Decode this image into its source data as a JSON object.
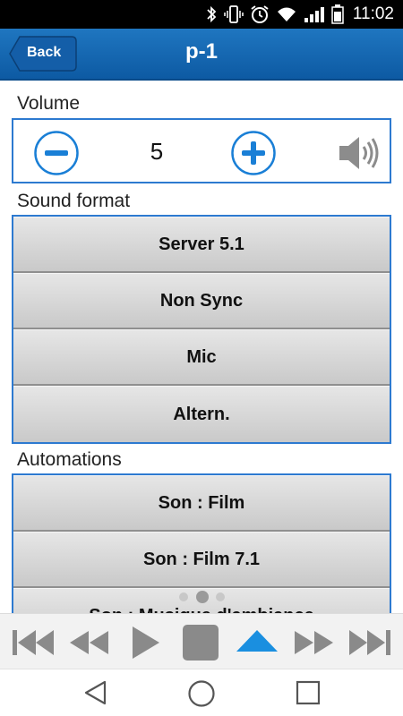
{
  "status_bar": {
    "time": "11:02",
    "icons": [
      "bluetooth-icon",
      "vibrate-icon",
      "alarm-icon",
      "wifi-icon",
      "signal-icon",
      "battery-icon"
    ]
  },
  "header": {
    "back_label": "Back",
    "title": "p-1"
  },
  "volume": {
    "label": "Volume",
    "value": "5",
    "accent": "#1a7fd6"
  },
  "sound_format": {
    "label": "Sound format",
    "buttons": [
      "Server 5.1",
      "Non Sync",
      "Mic",
      "Altern."
    ]
  },
  "automations": {
    "label": "Automations",
    "buttons": [
      "Son : Film",
      "Son : Film 7.1",
      "Son : Musique d'ambiance"
    ]
  },
  "pager": {
    "count": 3,
    "active_index": 1
  },
  "transport": {
    "icons": [
      "skip-to-start-icon",
      "rewind-icon",
      "play-icon",
      "stop-icon",
      "eject-icon",
      "fast-forward-icon",
      "skip-to-end-icon"
    ]
  },
  "nav_bar": {
    "icons": [
      "back-nav-icon",
      "home-nav-icon",
      "recents-nav-icon"
    ]
  },
  "colors": {
    "header": "#1565b0",
    "border": "#2d7ad0",
    "button_face": "#d6d6d6",
    "transport_icon": "#8a8a8a",
    "eject_icon": "#1a8fe0"
  }
}
